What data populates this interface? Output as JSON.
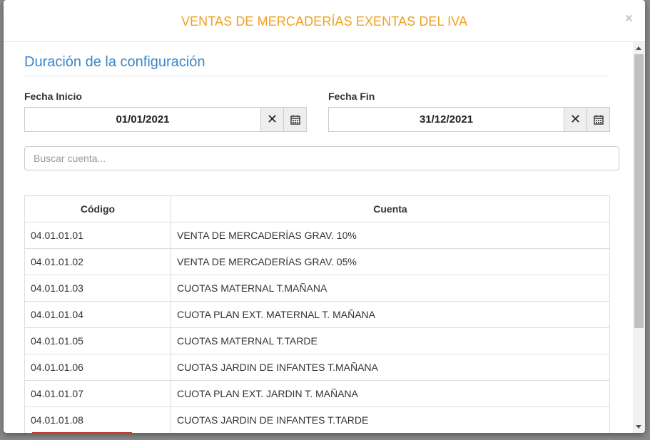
{
  "modal": {
    "title": "VENTAS DE MERCADERÍAS EXENTAS DEL IVA",
    "close_label": "×"
  },
  "config": {
    "section_title": "Duración de la configuración",
    "start_label": "Fecha Inicio",
    "start_value": "01/01/2021",
    "end_label": "Fecha Fin",
    "end_value": "31/12/2021"
  },
  "search": {
    "placeholder": "Buscar cuenta..."
  },
  "table": {
    "headers": [
      "Código",
      "Cuenta"
    ],
    "rows": [
      {
        "code": "04.01.01.01",
        "account": "VENTA DE MERCADERÍAS GRAV. 10%"
      },
      {
        "code": "04.01.01.02",
        "account": "VENTA DE MERCADERÍAS GRAV. 05%"
      },
      {
        "code": "04.01.01.03",
        "account": "CUOTAS MATERNAL T.MAÑANA"
      },
      {
        "code": "04.01.01.04",
        "account": "CUOTA PLAN EXT. MATERNAL T. MAÑANA"
      },
      {
        "code": "04.01.01.05",
        "account": "CUOTAS MATERNAL T.TARDE"
      },
      {
        "code": "04.01.01.06",
        "account": "CUOTAS JARDIN DE INFANTES T.MAÑANA"
      },
      {
        "code": "04.01.01.07",
        "account": "CUOTA PLAN EXT. JARDIN T. MAÑANA"
      },
      {
        "code": "04.01.01.08",
        "account": "CUOTAS JARDIN DE INFANTES T.TARDE"
      }
    ]
  },
  "icons": {
    "clear": "close-icon",
    "calendar": "calendar-icon"
  },
  "colors": {
    "title": "#f0a020",
    "section_title": "#3a87c8"
  }
}
